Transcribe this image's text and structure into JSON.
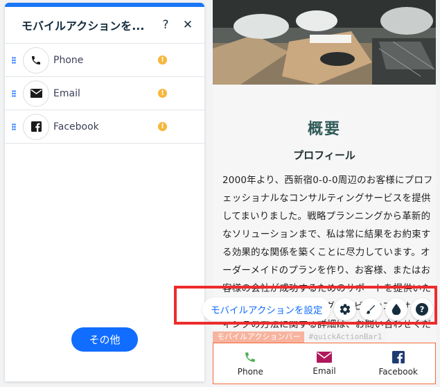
{
  "panel": {
    "title": "モバイルアクションを...",
    "help_label": "?",
    "close_label": "✕",
    "items": [
      {
        "label": "Phone",
        "icon": "phone-icon",
        "warning": "!"
      },
      {
        "label": "Email",
        "icon": "envelope-icon",
        "warning": "!"
      },
      {
        "label": "Facebook",
        "icon": "facebook-icon",
        "warning": "!"
      }
    ],
    "more_label": "その他"
  },
  "preview": {
    "title": "概要",
    "subtitle": "プロフィール",
    "body": "2000年より、西新宿0-0-0周辺のお客様にプロフェッショナルなコンサルティングサービスを提供してまいりました。戦略プランニングから革新的なソリューションまで、私は常に結果をお約束する効果的な関係を築くことに尽力しています。オーダーメイドのプランを作り、お客様、またはお客様の会社が成功するためのサポートを提供いたします。コンサルティングサービスやコンサルティングの方法に関する詳細は、お問い合わせください。",
    "tag_name": "モバイルアクションバー",
    "tag_id": "#quickActionBar1",
    "bar": [
      {
        "label": "Phone",
        "icon": "phone-icon"
      },
      {
        "label": "Email",
        "icon": "envelope-icon"
      },
      {
        "label": "Facebook",
        "icon": "facebook-icon"
      }
    ]
  },
  "toolbar": {
    "main_label": "モバイルアクションを設定",
    "icons": [
      "gear-icon",
      "brush-icon",
      "drop-icon",
      "help-icon"
    ]
  },
  "colors": {
    "accent": "#116dff",
    "warning": "#f6b73c",
    "highlight": "#ee2b2b",
    "phone": "#4caf50",
    "email": "#b0175a",
    "facebook": "#1f3b73",
    "selection": "#f26a36"
  }
}
